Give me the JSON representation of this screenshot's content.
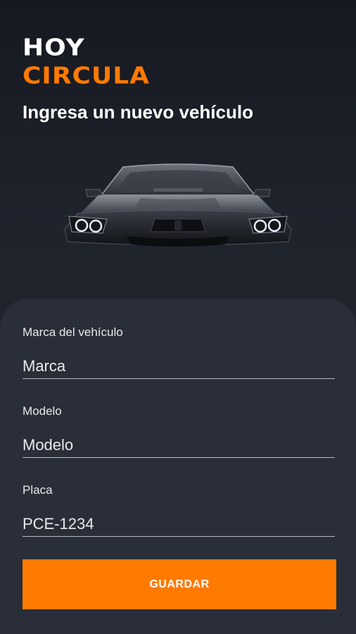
{
  "app": {
    "logo_line1": "HOY",
    "logo_line2": "CIRCULA",
    "subtitle": "Ingresa un nuevo vehículo"
  },
  "hero": {
    "icon": "car-front-image"
  },
  "form": {
    "fields": [
      {
        "label": "Marca del vehículo",
        "placeholder": "Marca",
        "value": ""
      },
      {
        "label": "Modelo",
        "placeholder": "Modelo",
        "value": ""
      },
      {
        "label": "Placa",
        "placeholder": "PCE-1234",
        "value": ""
      }
    ],
    "save_label": "GUARDAR"
  },
  "colors": {
    "accent": "#ff7a00",
    "background": "#1f232c",
    "card": "#2a2e38",
    "text": "#ffffff"
  }
}
